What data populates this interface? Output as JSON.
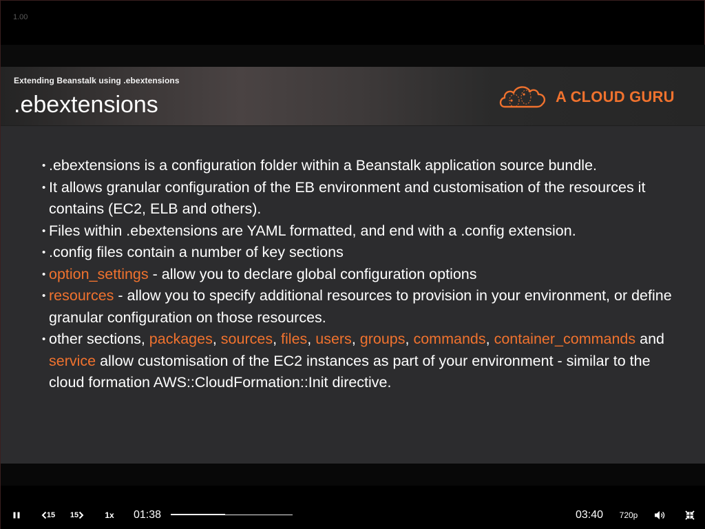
{
  "player": {
    "speed_indicator": "1.00",
    "slide": {
      "subtitle": "Extending Beanstalk using .ebextensions",
      "title": ".ebextensions",
      "brand_name": "A CLOUD GURU",
      "accent_color": "#f0722e",
      "bullets": [
        {
          "segments": [
            {
              "text": ".ebextensions is a configuration folder within a Beanstalk application source bundle."
            }
          ]
        },
        {
          "segments": [
            {
              "text": "It allows granular configuration of the EB environment and customisation of the resources it contains (EC2, ELB and others)."
            }
          ]
        },
        {
          "segments": [
            {
              "text": "Files within .ebextensions are YAML formatted, and end with a .config extension."
            }
          ]
        },
        {
          "segments": [
            {
              "text": ".config files contain a number of key sections"
            }
          ]
        },
        {
          "segments": [
            {
              "text": "option_settings",
              "hl": true
            },
            {
              "text": " - allow you to declare global configuration options"
            }
          ]
        },
        {
          "segments": [
            {
              "text": "resources",
              "hl": true
            },
            {
              "text": " - allow you to specify additional resources to provision in your environment, or define granular configuration on those resources."
            }
          ]
        },
        {
          "segments": [
            {
              "text": "other sections, "
            },
            {
              "text": "packages",
              "hl": true
            },
            {
              "text": ", "
            },
            {
              "text": "sources",
              "hl": true
            },
            {
              "text": ", "
            },
            {
              "text": "files",
              "hl": true
            },
            {
              "text": ", "
            },
            {
              "text": "users",
              "hl": true
            },
            {
              "text": ", "
            },
            {
              "text": "groups",
              "hl": true
            },
            {
              "text": ", "
            },
            {
              "text": "commands",
              "hl": true
            },
            {
              "text": ", "
            },
            {
              "text": "container_commands",
              "hl": true
            },
            {
              "text": " and "
            },
            {
              "text": "service",
              "hl": true
            },
            {
              "text": " allow customisation of the EC2 instances as part of your environment - similar to the cloud formation AWS::CloudFormation::Init directive."
            }
          ]
        }
      ]
    },
    "controls": {
      "play_pause_icon": "pause-icon",
      "skip_back_label": "15",
      "skip_forward_label": "15",
      "speed_label": "1x",
      "current_time": "01:38",
      "total_time": "03:40",
      "progress_fraction": 0.445,
      "quality_label": "720p",
      "volume_icon": "speaker-icon",
      "fullscreen_icon": "exit-fullscreen-icon"
    }
  }
}
